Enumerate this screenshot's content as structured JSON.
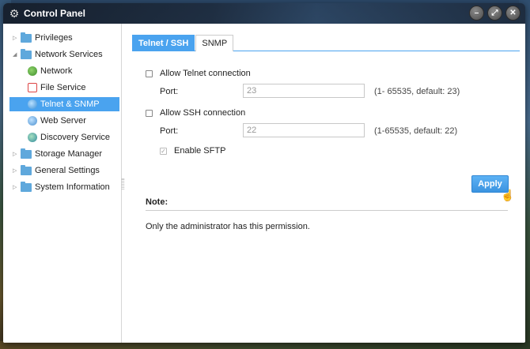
{
  "window": {
    "title": "Control Panel",
    "icon": "gear-icon",
    "buttons": [
      "minimize-icon",
      "maximize-icon",
      "close-icon"
    ]
  },
  "sidebar": {
    "items": [
      {
        "label": "Privileges",
        "type": "folder",
        "expanded": false
      },
      {
        "label": "Network Services",
        "type": "folder",
        "expanded": true
      },
      {
        "label": "Network",
        "type": "leaf",
        "icon": "globe-icon"
      },
      {
        "label": "File Service",
        "type": "leaf",
        "icon": "file-service-icon"
      },
      {
        "label": "Telnet & SNMP",
        "type": "leaf",
        "icon": "telnet-icon",
        "selected": true
      },
      {
        "label": "Web Server",
        "type": "leaf",
        "icon": "web-server-icon"
      },
      {
        "label": "Discovery Service",
        "type": "leaf",
        "icon": "discovery-icon"
      },
      {
        "label": "Storage Manager",
        "type": "folder",
        "expanded": false
      },
      {
        "label": "General Settings",
        "type": "folder",
        "expanded": false
      },
      {
        "label": "System Information",
        "type": "folder",
        "expanded": false
      }
    ]
  },
  "main": {
    "tabs": [
      {
        "label": "Telnet / SSH",
        "active": true
      },
      {
        "label": "SNMP",
        "active": false
      }
    ],
    "telnet": {
      "checkbox_label": "Allow Telnet connection",
      "checked": false,
      "port_label": "Port:",
      "port_value": "23",
      "range": "(1- 65535, default: 23)"
    },
    "ssh": {
      "checkbox_label": "Allow SSH connection",
      "checked": false,
      "port_label": "Port:",
      "port_value": "22",
      "range": "(1-65535, default: 22)",
      "sftp_label": "Enable SFTP",
      "sftp_checked": true
    },
    "apply_label": "Apply",
    "note_title": "Note:",
    "note_text": "Only the administrator has this permission."
  },
  "colors": {
    "accent": "#4aa3ef",
    "selected_bg": "#4aa3ef",
    "folder": "#5fa8dc"
  }
}
